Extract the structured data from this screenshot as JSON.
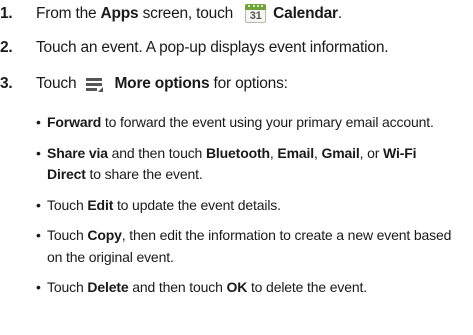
{
  "steps": [
    {
      "number": "1.",
      "text_a": "From the ",
      "bold_a": "Apps",
      "text_b": " screen, touch ",
      "icon": "calendar-icon",
      "icon_text": "31",
      "bold_b": "Calendar",
      "text_c": "."
    },
    {
      "number": "2.",
      "text": "Touch an event. A pop-up displays event information."
    },
    {
      "number": "3.",
      "text_a": "Touch ",
      "icon": "more-options-icon",
      "bold_a": "More options",
      "text_b": " for options:"
    }
  ],
  "options": [
    {
      "parts": [
        {
          "bold": "Forward"
        },
        {
          "text": " to forward the event using your primary email account."
        }
      ]
    },
    {
      "parts": [
        {
          "bold": "Share via"
        },
        {
          "text": " and then touch "
        },
        {
          "bold": "Bluetooth"
        },
        {
          "text": ", "
        },
        {
          "bold": "Email"
        },
        {
          "text": ", "
        },
        {
          "bold": "Gmail"
        },
        {
          "text": ", or "
        },
        {
          "bold": "Wi-Fi Direct"
        },
        {
          "text": " to share the event."
        }
      ]
    },
    {
      "parts": [
        {
          "text": "Touch "
        },
        {
          "bold": "Edit"
        },
        {
          "text": " to update the event details."
        }
      ]
    },
    {
      "parts": [
        {
          "text": "Touch "
        },
        {
          "bold": "Copy"
        },
        {
          "text": ", then edit the information to create a new event based on the original event."
        }
      ]
    },
    {
      "parts": [
        {
          "text": "Touch "
        },
        {
          "bold": "Delete"
        },
        {
          "text": " and then touch "
        },
        {
          "bold": "OK"
        },
        {
          "text": " to delete the event."
        }
      ]
    }
  ],
  "colors": {
    "text": "#1a1a1a",
    "calendar_green": "#6fa33a"
  }
}
